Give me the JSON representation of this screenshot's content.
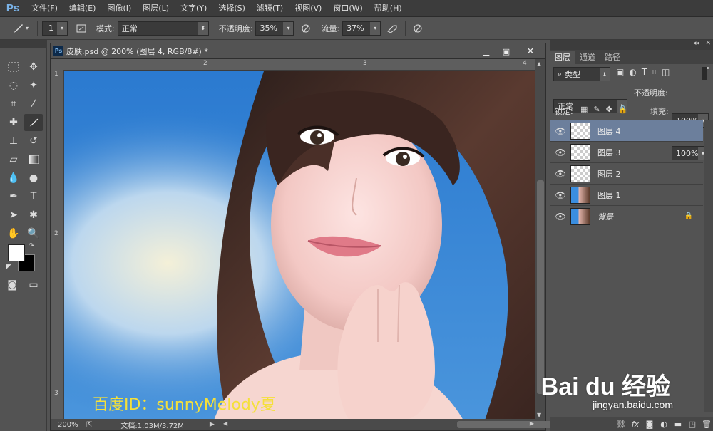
{
  "app": {
    "logo": "Ps"
  },
  "menu": [
    "文件(F)",
    "编辑(E)",
    "图像(I)",
    "图层(L)",
    "文字(Y)",
    "选择(S)",
    "滤镜(T)",
    "视图(V)",
    "窗口(W)",
    "帮助(H)"
  ],
  "options": {
    "brush_size": "1",
    "mode_label": "模式:",
    "mode_value": "正常",
    "opacity_label": "不透明度:",
    "opacity_value": "35%",
    "flow_label": "流量:",
    "flow_value": "37%"
  },
  "document": {
    "tab_title": "皮肤.psd @ 200% (图层 4, RGB/8#) *",
    "ruler_top": [
      "2",
      "3",
      "4"
    ],
    "ruler_left": [
      "1",
      "2",
      "3"
    ],
    "zoom": "200%",
    "doc_info": "文档:1.03M/3.72M",
    "watermark": "百度ID：sunnyMelody夏"
  },
  "layers_panel": {
    "tabs": [
      "图层",
      "通道",
      "路径"
    ],
    "filter_kind": "类型",
    "blend_mode": "正常",
    "opacity_label": "不透明度:",
    "opacity_value": "100%",
    "lock_label": "锁定:",
    "fill_label": "填充:",
    "fill_value": "100%",
    "layers": [
      {
        "name": "图层 4",
        "selected": true,
        "thumb": "transparent"
      },
      {
        "name": "图层 3",
        "selected": false,
        "thumb": "transparent"
      },
      {
        "name": "图层 2",
        "selected": false,
        "thumb": "transparent"
      },
      {
        "name": "图层 1",
        "selected": false,
        "thumb": "photo"
      },
      {
        "name": "背景",
        "selected": false,
        "thumb": "photo",
        "locked": true
      }
    ]
  },
  "branding": {
    "baidu_logo": "Bai du 经验",
    "baidu_url": "jingyan.baidu.com"
  },
  "colors": {
    "selected_layer": "#6c7f9c",
    "canvas_sky": "#2e7fd2",
    "watermark": "#f5e03a"
  }
}
